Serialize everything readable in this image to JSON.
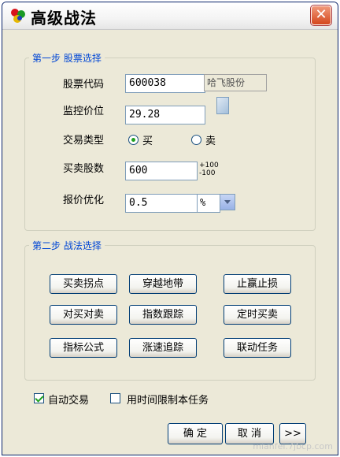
{
  "window": {
    "title": "高级战法",
    "close_label": "✕"
  },
  "step1": {
    "title": "第一步  股票选择",
    "stock_code_label": "股票代码",
    "stock_code_value": "600038",
    "stock_name": "哈飞股份",
    "monitor_price_label": "监控价位",
    "monitor_price_value": "29.28",
    "trade_type_label": "交易类型",
    "buy_label": "买",
    "sell_label": "卖",
    "buy_checked": true,
    "shares_label": "买卖股数",
    "shares_value": "600",
    "stepper_up": "+100",
    "stepper_down": "-100",
    "quote_label": "报价优化",
    "quote_value": "0.5",
    "quote_unit": "%"
  },
  "step2": {
    "title": "第二步  战法选择",
    "buttons": [
      "买卖拐点",
      "穿越地带",
      "止赢止损",
      "对买对卖",
      "指数跟踪",
      "定时买卖",
      "指标公式",
      "涨速追踪",
      "联动任务"
    ]
  },
  "options": {
    "auto_trade_label": "自动交易",
    "auto_trade_checked": true,
    "time_limit_label": "用时间限制本任务",
    "time_limit_checked": false
  },
  "footer": {
    "ok": "确 定",
    "cancel": "取 消",
    "more": ">>"
  },
  "watermark": "mianfei.7jbcp.com",
  "colors": {
    "group_title": "#0046d5",
    "close_button": "#d4461c",
    "window_bg": "#ece9d8"
  }
}
